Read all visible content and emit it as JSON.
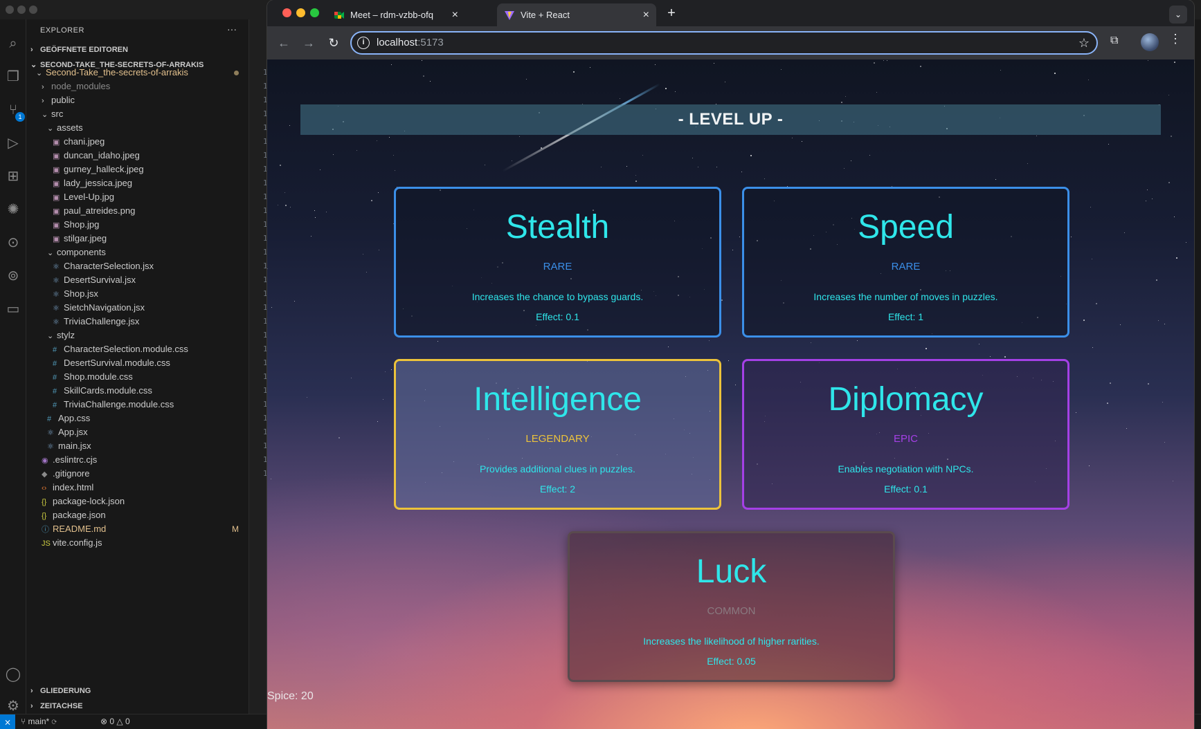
{
  "vscode": {
    "explorer_title": "EXPLORER",
    "more_actions": "···",
    "open_editors": "GEÖFFNETE EDITOREN",
    "root": "SECOND-TAKE_THE-SECRETS-OF-ARRAKIS",
    "source_control_badge": "1",
    "tree": [
      {
        "label": "Second-Take_the-secrets-of-arrakis",
        "indent": 0,
        "kind": "folder-open",
        "color": "#e2c08d"
      },
      {
        "label": "node_modules",
        "indent": 1,
        "kind": "folder",
        "color": "#8b8b8b"
      },
      {
        "label": "public",
        "indent": 1,
        "kind": "folder",
        "color": "#cccccc"
      },
      {
        "label": "src",
        "indent": 1,
        "kind": "folder-open",
        "color": "#cccccc"
      },
      {
        "label": "assets",
        "indent": 2,
        "kind": "folder-open",
        "color": "#cccccc"
      },
      {
        "label": "chani.jpeg",
        "indent": 3,
        "kind": "image",
        "color": "#cccccc"
      },
      {
        "label": "duncan_idaho.jpeg",
        "indent": 3,
        "kind": "image",
        "color": "#cccccc"
      },
      {
        "label": "gurney_halleck.jpeg",
        "indent": 3,
        "kind": "image",
        "color": "#cccccc"
      },
      {
        "label": "lady_jessica.jpeg",
        "indent": 3,
        "kind": "image",
        "color": "#cccccc"
      },
      {
        "label": "Level-Up.jpg",
        "indent": 3,
        "kind": "image",
        "color": "#cccccc"
      },
      {
        "label": "paul_atreides.png",
        "indent": 3,
        "kind": "image",
        "color": "#cccccc"
      },
      {
        "label": "Shop.jpg",
        "indent": 3,
        "kind": "image",
        "color": "#cccccc"
      },
      {
        "label": "stilgar.jpeg",
        "indent": 3,
        "kind": "image",
        "color": "#cccccc"
      },
      {
        "label": "components",
        "indent": 2,
        "kind": "folder-open",
        "color": "#cccccc"
      },
      {
        "label": "CharacterSelection.jsx",
        "indent": 3,
        "kind": "react",
        "color": "#cccccc"
      },
      {
        "label": "DesertSurvival.jsx",
        "indent": 3,
        "kind": "react",
        "color": "#cccccc"
      },
      {
        "label": "Shop.jsx",
        "indent": 3,
        "kind": "react",
        "color": "#cccccc"
      },
      {
        "label": "SietchNavigation.jsx",
        "indent": 3,
        "kind": "react",
        "color": "#cccccc"
      },
      {
        "label": "TriviaChallenge.jsx",
        "indent": 3,
        "kind": "react",
        "color": "#cccccc"
      },
      {
        "label": "stylz",
        "indent": 2,
        "kind": "folder-open",
        "color": "#cccccc"
      },
      {
        "label": "CharacterSelection.module.css",
        "indent": 3,
        "kind": "css",
        "color": "#cccccc"
      },
      {
        "label": "DesertSurvival.module.css",
        "indent": 3,
        "kind": "css",
        "color": "#cccccc"
      },
      {
        "label": "Shop.module.css",
        "indent": 3,
        "kind": "css",
        "color": "#cccccc"
      },
      {
        "label": "SkillCards.module.css",
        "indent": 3,
        "kind": "css",
        "color": "#cccccc"
      },
      {
        "label": "TriviaChallenge.module.css",
        "indent": 3,
        "kind": "css",
        "color": "#cccccc"
      },
      {
        "label": "App.css",
        "indent": 2,
        "kind": "css",
        "color": "#cccccc"
      },
      {
        "label": "App.jsx",
        "indent": 2,
        "kind": "react",
        "color": "#cccccc"
      },
      {
        "label": "main.jsx",
        "indent": 2,
        "kind": "react",
        "color": "#cccccc"
      },
      {
        "label": ".eslintrc.cjs",
        "indent": 1,
        "kind": "eslint",
        "color": "#cccccc"
      },
      {
        "label": ".gitignore",
        "indent": 1,
        "kind": "git",
        "color": "#cccccc"
      },
      {
        "label": "index.html",
        "indent": 1,
        "kind": "html",
        "color": "#cccccc"
      },
      {
        "label": "package-lock.json",
        "indent": 1,
        "kind": "json",
        "color": "#cccccc"
      },
      {
        "label": "package.json",
        "indent": 1,
        "kind": "json",
        "color": "#cccccc"
      },
      {
        "label": "README.md",
        "indent": 1,
        "kind": "info",
        "color": "#e2c08d",
        "git": "M"
      },
      {
        "label": "vite.config.js",
        "indent": 1,
        "kind": "js",
        "color": "#cccccc"
      }
    ],
    "outline": "GLIEDERUNG",
    "timeline": "ZEITACHSE",
    "status": {
      "branch": "main*",
      "problems": "0",
      "warnings": "0"
    }
  },
  "chrome": {
    "tabs": [
      {
        "title": "Meet – rdm-vzbb-ofq",
        "active": false
      },
      {
        "title": "Vite + React",
        "active": true
      }
    ],
    "url_host": "localhost",
    "url_port": ":5173"
  },
  "page": {
    "title": "- LEVEL UP -",
    "cards": [
      {
        "id": "stealth",
        "name": "Stealth",
        "rarity": "RARE",
        "rarity_color": "#3b8fe8",
        "description": "Increases the chance to bypass guards.",
        "effect": "Effect: 0.1"
      },
      {
        "id": "speed",
        "name": "Speed",
        "rarity": "RARE",
        "rarity_color": "#3b8fe8",
        "description": "Increases the number of moves in puzzles.",
        "effect": "Effect: 1"
      },
      {
        "id": "intelligence",
        "name": "Intelligence",
        "rarity": "LEGENDARY",
        "rarity_color": "#ecc33b",
        "description": "Provides additional clues in puzzles.",
        "effect": "Effect: 2"
      },
      {
        "id": "diplomacy",
        "name": "Diplomacy",
        "rarity": "EPIC",
        "rarity_color": "#a540e6",
        "description": "Enables negotiation with NPCs.",
        "effect": "Effect: 0.1"
      },
      {
        "id": "luck",
        "name": "Luck",
        "rarity": "COMMON",
        "rarity_color": "#8a7a80",
        "description": "Increases the likelihood of higher rarities.",
        "effect": "Effect: 0.05"
      }
    ],
    "spice": "Spice: 20"
  }
}
